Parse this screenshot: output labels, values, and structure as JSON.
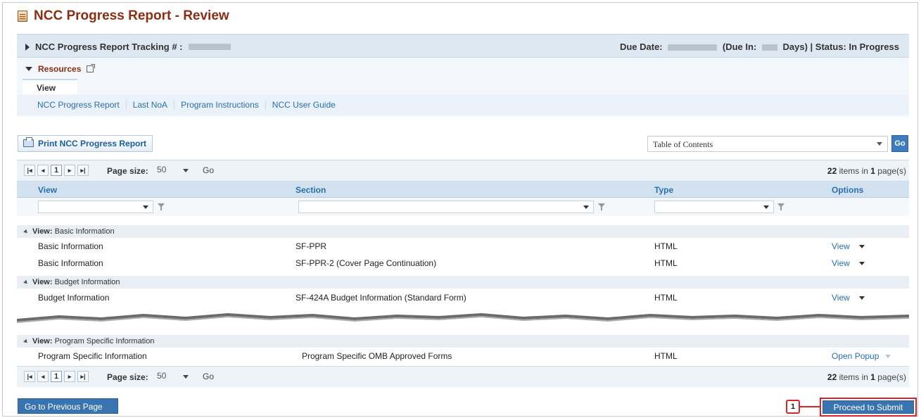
{
  "title": "NCC Progress Report - Review",
  "tracking": {
    "label": "NCC Progress Report Tracking # :",
    "due_prefix": "Due Date:",
    "due_in_prefix": "(Due In:",
    "due_in_suffix": "Days) | Status: In Progress"
  },
  "resources": {
    "heading": "Resources",
    "tab": "View",
    "links": [
      "NCC Progress Report",
      "Last NoA",
      "Program Instructions",
      "NCC User Guide"
    ]
  },
  "toolbar": {
    "print_label": "Print NCC Progress Report",
    "toc_value": "Table of Contents",
    "go_label": "Go"
  },
  "pager": {
    "current_page": "1",
    "page_size_label": "Page size:",
    "page_size_value": "50",
    "go_label": "Go",
    "count_num": "22",
    "count_items": " items in ",
    "count_pages_num": "1",
    "count_pages": " page(s)"
  },
  "table": {
    "columns": [
      "View",
      "Section",
      "Type",
      "Options"
    ],
    "groups": [
      {
        "label_prefix": "View:",
        "label": "Basic Information",
        "rows": [
          {
            "view": "Basic Information",
            "section": "SF-PPR",
            "type": "HTML",
            "option": "View"
          },
          {
            "view": "Basic Information",
            "section": "SF-PPR-2 (Cover Page Continuation)",
            "type": "HTML",
            "option": "View"
          }
        ]
      },
      {
        "label_prefix": "View:",
        "label": "Budget Information",
        "rows": [
          {
            "view": "Budget Information",
            "section": "SF-424A Budget Information (Standard Form)",
            "type": "HTML",
            "option": "View"
          }
        ]
      },
      {
        "label_prefix": "View:",
        "label": "Program Specific Information",
        "rows": [
          {
            "view": "Program Specific Information",
            "section": "Program Specific OMB Approved Forms",
            "type": "HTML",
            "option": "Open Popup"
          }
        ]
      }
    ]
  },
  "footer": {
    "prev_label": "Go to Previous Page",
    "callout_number": "1",
    "submit_label": "Proceed to Submit"
  },
  "colors": {
    "title": "#8b2d13",
    "link": "#2a6fae",
    "button": "#3a74b0",
    "callout": "#d9232d"
  }
}
